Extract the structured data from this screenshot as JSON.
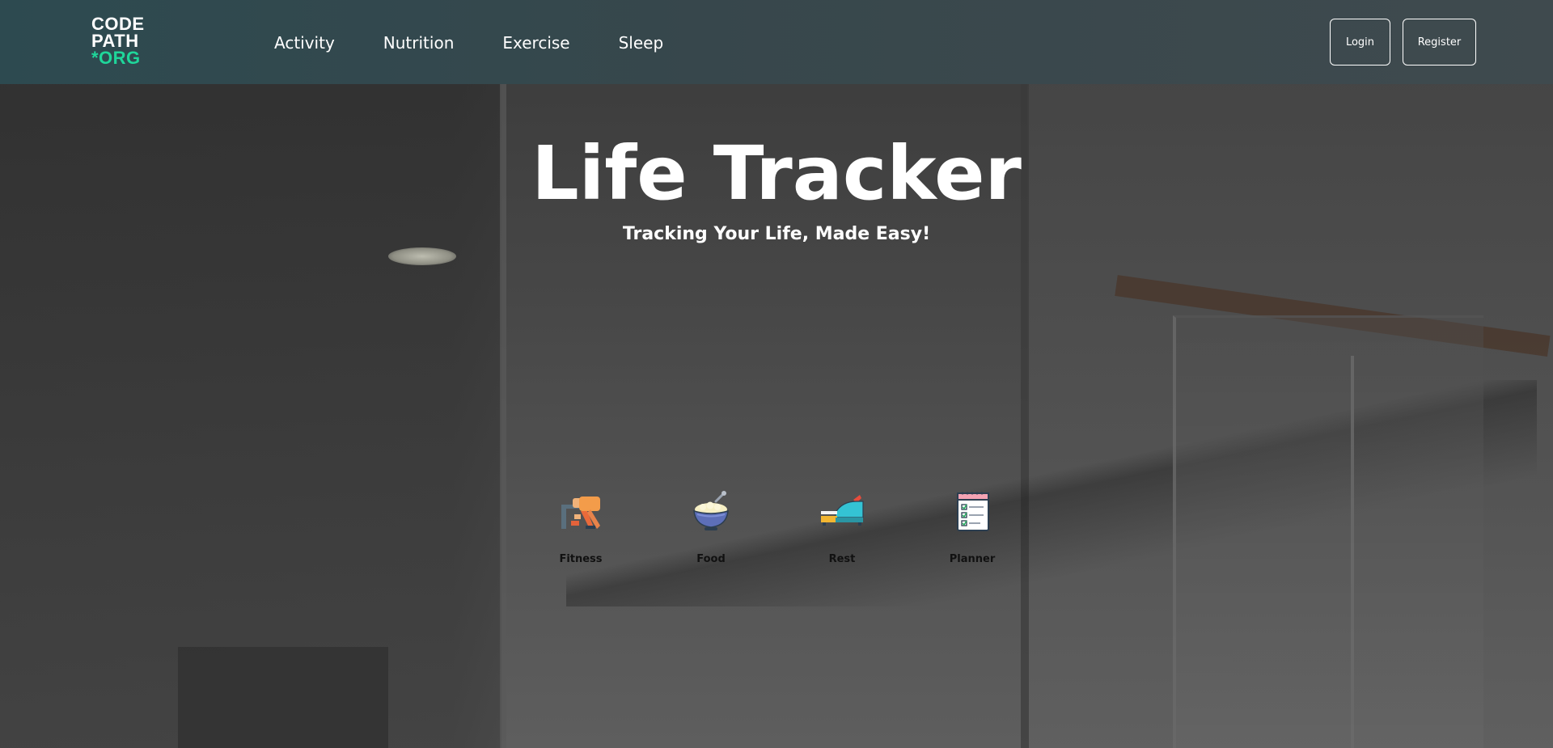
{
  "logo": {
    "line1": "CODE",
    "line2": "PATH",
    "line3": "*ORG",
    "accent_color": "#1fd69a"
  },
  "nav": {
    "links": [
      {
        "label": "Activity"
      },
      {
        "label": "Nutrition"
      },
      {
        "label": "Exercise"
      },
      {
        "label": "Sleep"
      }
    ],
    "login_label": "Login",
    "register_label": "Register"
  },
  "hero": {
    "title": "Life Tracker",
    "subtitle": "Tracking Your Life, Made Easy!"
  },
  "features": [
    {
      "label": "Fitness",
      "icon": "fitness-icon"
    },
    {
      "label": "Food",
      "icon": "food-bowl-icon"
    },
    {
      "label": "Rest",
      "icon": "rest-bed-icon"
    },
    {
      "label": "Planner",
      "icon": "planner-notepad-icon"
    }
  ]
}
